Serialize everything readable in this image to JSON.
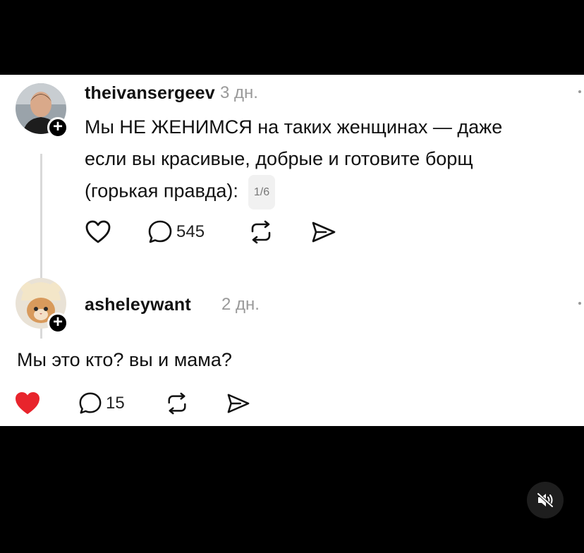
{
  "post1": {
    "username": "theivansergeev",
    "time": "3 дн.",
    "text_line1": "Мы НЕ ЖЕНИМСЯ на таких женщинах — даже",
    "text_line2": "если вы красивые, добрые и готовите борщ",
    "text_line3": "(горькая правда):",
    "page_counter": "1/6",
    "replies_count": "545",
    "liked": false
  },
  "post2": {
    "username": "asheleywant",
    "time": "2 дн.",
    "text": "Мы это кто? вы и мама?",
    "replies_count": "15",
    "liked": true
  },
  "colors": {
    "like_active": "#e8242c",
    "text": "#111111",
    "muted": "#999999"
  },
  "icons": {
    "follow": "plus-icon",
    "like": "heart-icon",
    "reply": "comment-bubble-icon",
    "repost": "repost-icon",
    "share": "send-icon",
    "mute": "speaker-muted-icon"
  }
}
